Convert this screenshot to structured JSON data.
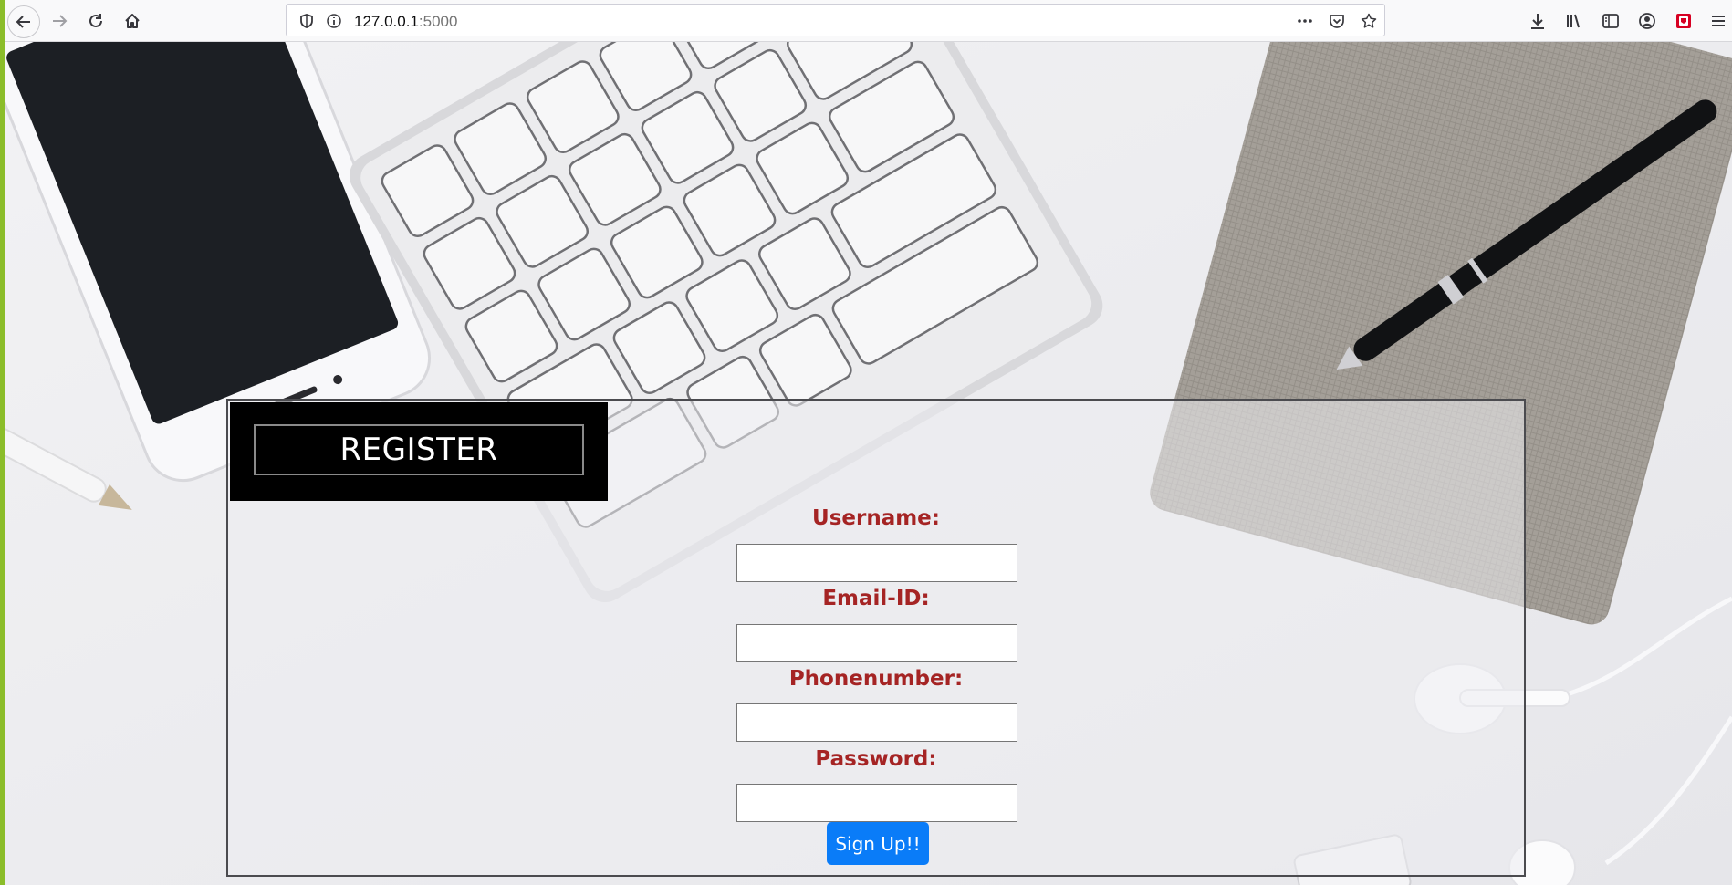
{
  "browser": {
    "url_host": "127.0.0.1",
    "url_port": ":5000",
    "icons": {
      "back": "back-arrow-icon",
      "forward": "forward-arrow-icon",
      "reload": "reload-icon",
      "home": "home-icon",
      "shield": "tracking-protection-shield-icon",
      "info": "site-info-icon",
      "more": "page-actions-more-icon",
      "pocket": "pocket-icon",
      "bookmark": "bookmark-star-icon",
      "downloads": "downloads-icon",
      "library": "library-icon",
      "sidebar": "sidebar-icon",
      "account": "account-icon",
      "extension": "extension-icon",
      "menu": "hamburger-menu-icon"
    }
  },
  "register": {
    "title": "REGISTER",
    "fields": [
      {
        "label": "Username:",
        "value": "",
        "placeholder": ""
      },
      {
        "label": "Email-ID:",
        "value": "",
        "placeholder": ""
      },
      {
        "label": "Phonenumber:",
        "value": "",
        "placeholder": ""
      },
      {
        "label": "Password:",
        "value": "",
        "placeholder": ""
      }
    ],
    "submit_label": "Sign Up!!"
  },
  "colors": {
    "label": "#a52424",
    "button": "#0a7cf8",
    "title_bg": "#000000",
    "accent_strip": "#8bbd2a"
  }
}
